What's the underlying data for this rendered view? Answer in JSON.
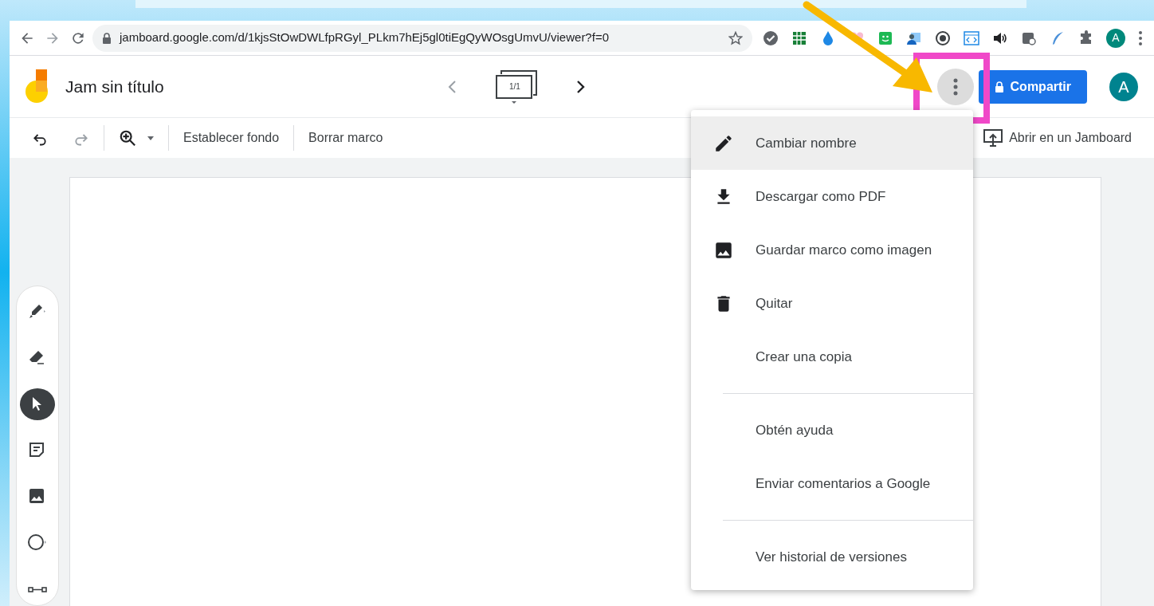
{
  "browser": {
    "url": "jamboard.google.com/d/1kjsStOwDWLfpRGyl_PLkm7hEj5gl0tiEgQyWOsgUmvU/viewer?f=0",
    "profile": "A"
  },
  "app": {
    "title": "Jam sin título",
    "frame_counter": "1/1",
    "share_button": "Compartir",
    "account": "A"
  },
  "toolbar": {
    "set_background": "Establecer fondo",
    "clear_frame": "Borrar marco",
    "open_in_jamboard": "Abrir en un Jamboard"
  },
  "tools": [
    {
      "kind": "pen",
      "selected": false
    },
    {
      "kind": "eraser",
      "selected": false
    },
    {
      "kind": "select",
      "selected": true
    },
    {
      "kind": "note",
      "selected": false
    },
    {
      "kind": "image",
      "selected": false
    },
    {
      "kind": "shape",
      "selected": false
    },
    {
      "kind": "textbox",
      "selected": false
    }
  ],
  "menu": {
    "groups": [
      [
        {
          "kind": "rename",
          "label": "Cambiar nombre",
          "highlighted": true
        },
        {
          "kind": "download",
          "label": "Descargar como PDF",
          "highlighted": false
        },
        {
          "kind": "image",
          "label": "Guardar marco como imagen",
          "highlighted": false
        },
        {
          "kind": "delete",
          "label": "Quitar",
          "highlighted": false
        },
        {
          "kind": "plain",
          "label": "Crear una copia",
          "highlighted": false
        }
      ],
      [
        {
          "kind": "plain",
          "label": "Obtén ayuda",
          "highlighted": false
        },
        {
          "kind": "plain",
          "label": "Enviar comentarios a Google",
          "highlighted": false
        }
      ],
      [
        {
          "kind": "plain",
          "label": "Ver historial de versiones",
          "highlighted": false
        }
      ]
    ]
  }
}
